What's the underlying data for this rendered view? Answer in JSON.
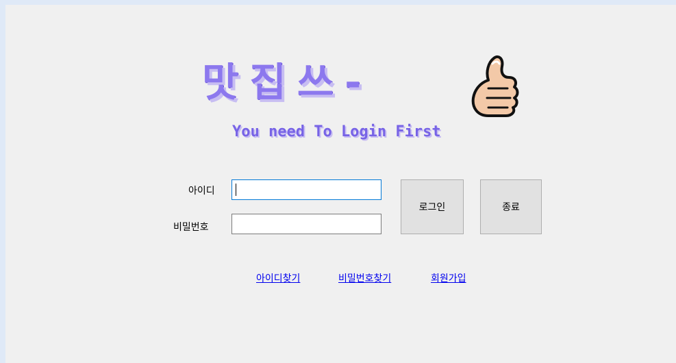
{
  "logo": {
    "title": "맛집쓰-",
    "tagline": "You need To Login First",
    "icon": "thumbs-up-icon"
  },
  "form": {
    "id_label": "아이디",
    "id_value": "",
    "pw_label": "비밀번호",
    "pw_value": ""
  },
  "buttons": {
    "login": "로그인",
    "exit": "종료"
  },
  "links": {
    "find_id": "아이디찾기",
    "find_pw": "비밀번호찾기",
    "signup": "회원가입"
  },
  "colors": {
    "accent": "#8c78ee",
    "link": "#0000ee",
    "window_bg": "#f0f0f0"
  }
}
